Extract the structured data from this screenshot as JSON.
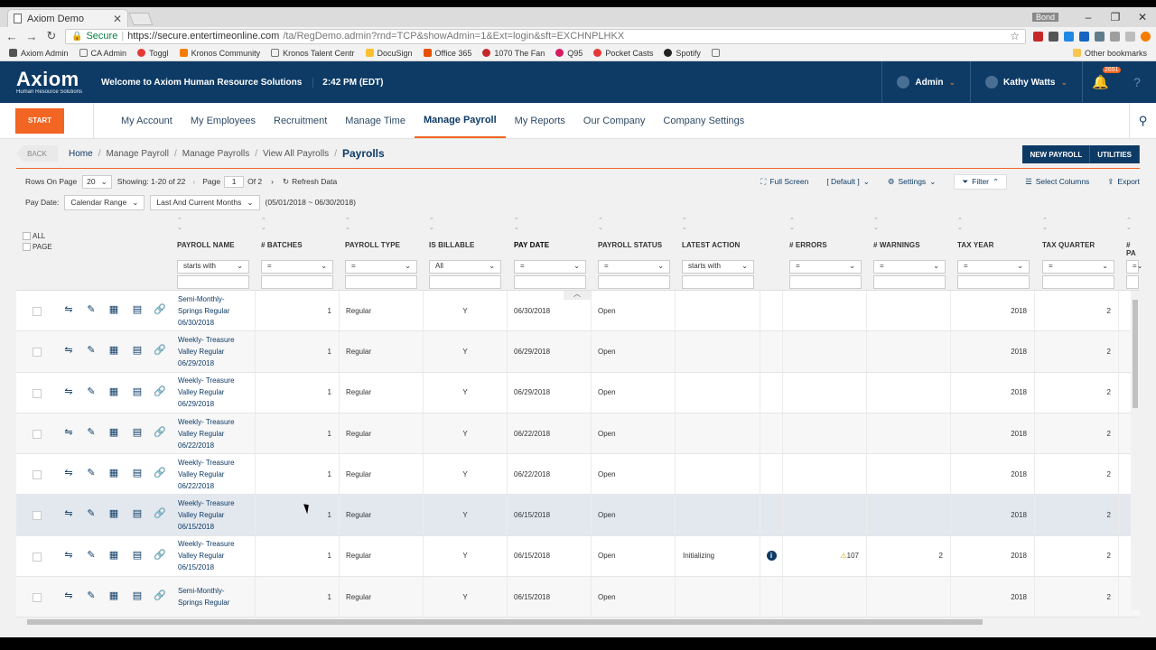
{
  "browser": {
    "tab_title": "Axiom Demo",
    "profile_label": "Bond",
    "url_secure": "Secure",
    "url_host": "https://secure.entertimeonline.com",
    "url_path": "/ta/RegDemo.admin?rnd=TCP&showAdmin=1&Ext=login&sft=EXCHNPLHKX",
    "bookmarks": [
      "Axiom Admin",
      "CA Admin",
      "Toggl",
      "Kronos Community",
      "Kronos Talent Centr",
      "DocuSign",
      "Office 365",
      "1070 The Fan",
      "Q95",
      "Pocket Casts",
      "Spotify"
    ],
    "other_bookmarks": "Other bookmarks"
  },
  "header": {
    "logo": "Axiom",
    "logo_sub": "Human Resource Solutions",
    "welcome": "Welcome to Axiom Human Resource Solutions",
    "time": "2:42 PM (EDT)",
    "role": "Admin",
    "user": "Kathy Watts",
    "notif_count": "2691"
  },
  "nav": {
    "start": "START",
    "items": [
      "My Account",
      "My Employees",
      "Recruitment",
      "Manage Time",
      "Manage Payroll",
      "My Reports",
      "Our Company",
      "Company Settings"
    ],
    "active": "Manage Payroll"
  },
  "breadcrumb": {
    "back": "BACK",
    "items": [
      "Home",
      "Manage Payroll",
      "Manage Payrolls",
      "View All Payrolls"
    ],
    "current": "Payrolls",
    "new_payroll": "NEW PAYROLL",
    "utilities": "UTILITIES"
  },
  "toolbar": {
    "rows_label": "Rows On Page",
    "rows_value": "20",
    "showing": "Showing: 1-20 of 22",
    "page_label": "Page",
    "page_value": "1",
    "of_pages": "Of 2",
    "refresh": "Refresh Data",
    "full_screen": "Full Screen",
    "view": "[ Default ]",
    "settings": "Settings",
    "filter": "Filter",
    "select_columns": "Select Columns",
    "export": "Export"
  },
  "pay_date": {
    "label": "Pay Date:",
    "range_type": "Calendar Range",
    "range": "Last And Current Months",
    "dates": "(05/01/2018 ~ 06/30/2018)"
  },
  "grid": {
    "select_all": "ALL",
    "select_page": "PAGE",
    "columns": [
      "PAYROLL NAME",
      "# BATCHES",
      "PAYROLL TYPE",
      "IS BILLABLE",
      "PAY DATE",
      "PAYROLL STATUS",
      "LATEST ACTION",
      "# ERRORS",
      "# WARNINGS",
      "TAX YEAR",
      "TAX QUARTER",
      "# PA"
    ],
    "filters": [
      "starts with",
      "=",
      "=",
      "All",
      "=",
      "=",
      "starts with",
      "=",
      "=",
      "=",
      "=",
      "="
    ],
    "rows": [
      {
        "name": [
          "Semi-Monthly-",
          "Springs Regular",
          "06/30/2018"
        ],
        "batches": "1",
        "type": "Regular",
        "billable": "Y",
        "pay_date": "06/30/2018",
        "status": "Open",
        "action": "",
        "errors": "",
        "warnings": "",
        "tax_year": "2018",
        "tax_quarter": "2"
      },
      {
        "name": [
          "Weekly- Treasure",
          "Valley Regular",
          "06/29/2018"
        ],
        "batches": "1",
        "type": "Regular",
        "billable": "Y",
        "pay_date": "06/29/2018",
        "status": "Open",
        "action": "",
        "errors": "",
        "warnings": "",
        "tax_year": "2018",
        "tax_quarter": "2"
      },
      {
        "name": [
          "Weekly- Treasure",
          "Valley Regular",
          "06/29/2018"
        ],
        "batches": "1",
        "type": "Regular",
        "billable": "Y",
        "pay_date": "06/29/2018",
        "status": "Open",
        "action": "",
        "errors": "",
        "warnings": "",
        "tax_year": "2018",
        "tax_quarter": "2"
      },
      {
        "name": [
          "Weekly- Treasure",
          "Valley Regular",
          "06/22/2018"
        ],
        "batches": "1",
        "type": "Regular",
        "billable": "Y",
        "pay_date": "06/22/2018",
        "status": "Open",
        "action": "",
        "errors": "",
        "warnings": "",
        "tax_year": "2018",
        "tax_quarter": "2"
      },
      {
        "name": [
          "Weekly- Treasure",
          "Valley Regular",
          "06/22/2018"
        ],
        "batches": "1",
        "type": "Regular",
        "billable": "Y",
        "pay_date": "06/22/2018",
        "status": "Open",
        "action": "",
        "errors": "",
        "warnings": "",
        "tax_year": "2018",
        "tax_quarter": "2"
      },
      {
        "name": [
          "Weekly- Treasure",
          "Valley Regular",
          "06/15/2018"
        ],
        "batches": "1",
        "type": "Regular",
        "billable": "Y",
        "pay_date": "06/15/2018",
        "status": "Open",
        "action": "",
        "errors": "",
        "warnings": "",
        "tax_year": "2018",
        "tax_quarter": "2"
      },
      {
        "name": [
          "Weekly- Treasure",
          "Valley Regular",
          "06/15/2018"
        ],
        "batches": "1",
        "type": "Regular",
        "billable": "Y",
        "pay_date": "06/15/2018",
        "status": "Open",
        "action": "Initializing",
        "errors": "107",
        "warnings": "2",
        "tax_year": "2018",
        "tax_quarter": "2"
      },
      {
        "name": [
          "Semi-Monthly-",
          "Springs Regular",
          ""
        ],
        "batches": "1",
        "type": "Regular",
        "billable": "Y",
        "pay_date": "06/15/2018",
        "status": "Open",
        "action": "",
        "errors": "",
        "warnings": "",
        "tax_year": "2018",
        "tax_quarter": "2"
      }
    ]
  }
}
